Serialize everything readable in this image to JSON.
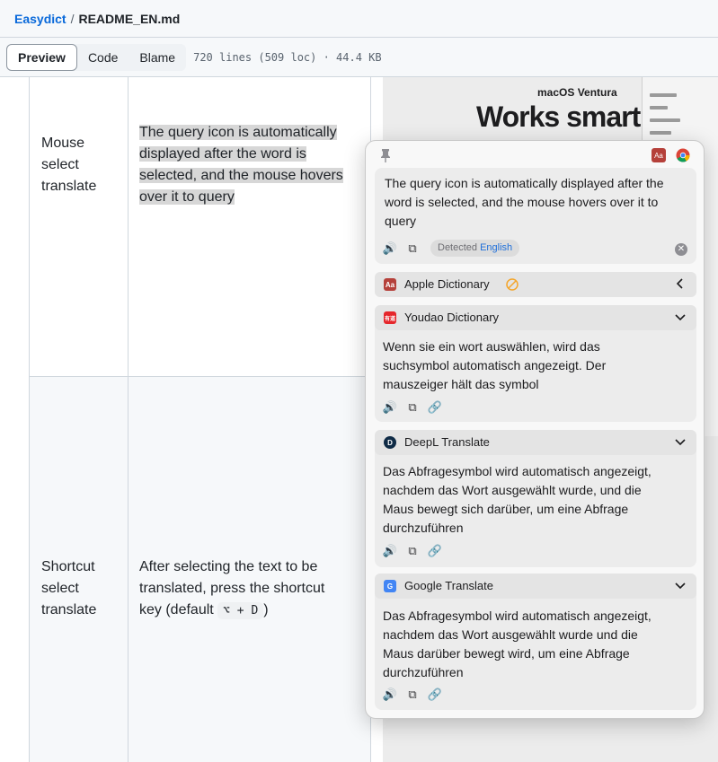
{
  "breadcrumb": {
    "repo": "Easydict",
    "sep": "/",
    "file": "README_EN.md"
  },
  "viewbar": {
    "tabs": [
      {
        "label": "Preview",
        "active": true
      },
      {
        "label": "Code",
        "active": false
      },
      {
        "label": "Blame",
        "active": false
      }
    ],
    "file_info": "720 lines (509 loc) · 44.4 KB"
  },
  "table": {
    "rows": [
      {
        "name_lines": [
          "Mouse",
          "select",
          "translate"
        ],
        "desc_lines": [
          "The query icon is automatically",
          "displayed after the word is",
          "selected, and the mouse hovers",
          "over it to query"
        ]
      },
      {
        "name_lines": [
          "Shortcut",
          "select",
          "translate"
        ],
        "desc_lines": [
          "After selecting the text to be",
          "translated, press the shortcut"
        ],
        "desc_prefix": "key (default ",
        "kbd": "⌥ + D",
        "desc_suffix": ")"
      }
    ]
  },
  "screenshot": {
    "subtitle": "macOS Ventura",
    "title": "Works smart"
  },
  "popup": {
    "query_lines": [
      "The query icon is automatically displayed after the",
      "word is selected, and the mouse hovers over it to",
      "query"
    ],
    "detected_label": "Detected",
    "detected_lang": "English",
    "services": [
      {
        "name": "Apple Dictionary",
        "logo": "Aa",
        "color": "#b5403a",
        "collapsed": true
      },
      {
        "name": "Youdao Dictionary",
        "logo": "有道",
        "color": "#e5262b",
        "result_lines": [
          "Wenn sie ein wort auswählen, wird das",
          "suchsymbol automatisch angezeigt. Der",
          "mauszeiger hält das symbol"
        ]
      },
      {
        "name": "DeepL Translate",
        "logo": "D",
        "color": "#0f2b46",
        "result_lines": [
          "Das Abfragesymbol wird automatisch angezeigt,",
          "nachdem das Wort ausgewählt wurde, und die",
          "Maus bewegt sich darüber, um eine Abfrage",
          "durchzuführen"
        ]
      },
      {
        "name": "Google Translate",
        "logo": "G",
        "color": "#4285f4",
        "result_lines": [
          "Das Abfragesymbol wird automatisch angezeigt,",
          "nachdem das Wort ausgewählt wurde und die",
          "Maus darüber bewegt wird, um eine Abfrage",
          "durchzuführen"
        ]
      }
    ],
    "accent": "#f4a52a"
  }
}
